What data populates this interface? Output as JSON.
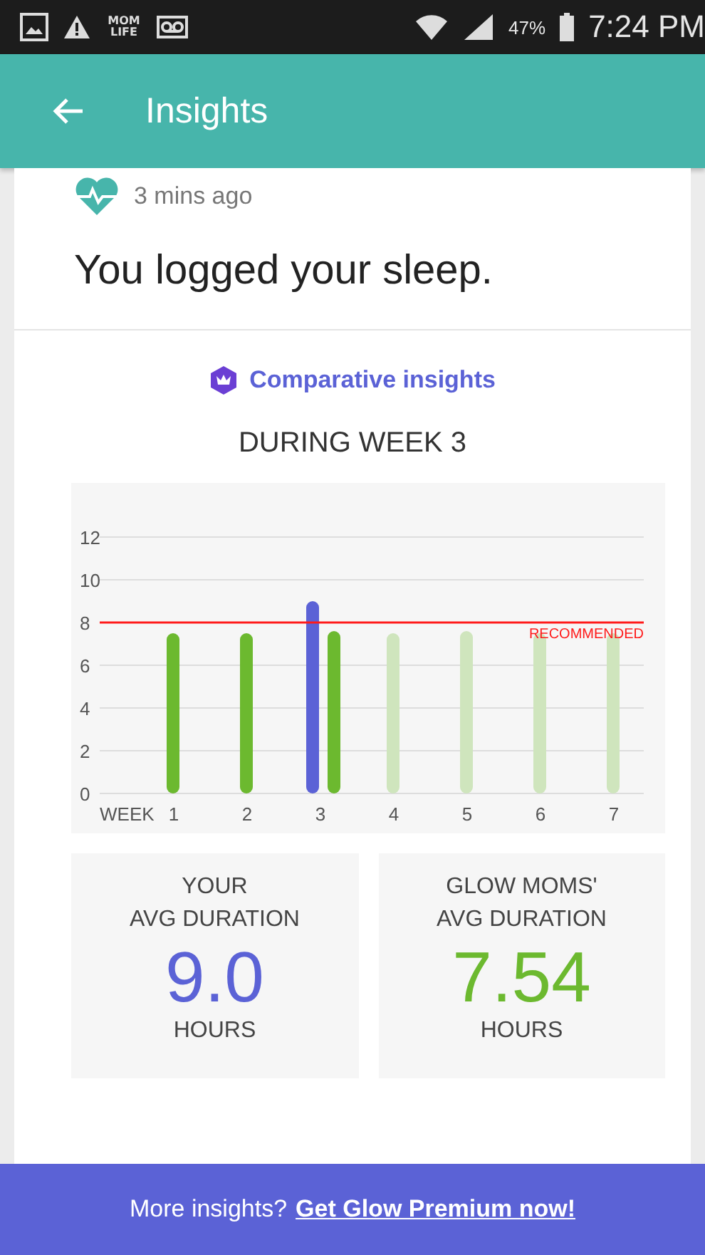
{
  "status_bar": {
    "notifications": [
      {
        "kind": "picture"
      },
      {
        "kind": "warning"
      },
      {
        "kind": "app",
        "label": "MOM LIFE"
      },
      {
        "kind": "voicemail"
      }
    ],
    "battery": "47%",
    "time": "7:24 PM"
  },
  "app_bar": {
    "title": "Insights"
  },
  "card": {
    "time": "3 mins ago",
    "title": "You logged your sleep.",
    "insights_label": "Comparative insights",
    "period": "DURING WEEK 3",
    "chart_data": {
      "type": "bar",
      "categories": [
        "1",
        "2",
        "3",
        "4",
        "5",
        "6",
        "7"
      ],
      "xlabel": "WEEK",
      "ylim": [
        0,
        12
      ],
      "yticks": [
        0,
        2,
        4,
        6,
        8,
        10,
        12
      ],
      "grid": true,
      "series": [
        {
          "color": "#5b62d6",
          "values": [
            null,
            null,
            9.0,
            null,
            null,
            null,
            null
          ]
        },
        {
          "color": "#6cb92f",
          "values": [
            7.5,
            7.5,
            7.6,
            null,
            null,
            null,
            null
          ]
        },
        {
          "color": "#cfe5bd",
          "values": [
            null,
            null,
            null,
            7.5,
            7.6,
            7.5,
            7.5
          ]
        }
      ],
      "ref_lines": [
        {
          "axis": "y",
          "value": 8,
          "label": "RECOMMENDED",
          "color": "#ff1a1a"
        }
      ]
    },
    "stats": [
      {
        "label_lines": [
          "YOUR",
          "AVG DURATION"
        ],
        "value": "9.0",
        "unit": "HOURS",
        "color": "#5b62d6"
      },
      {
        "label_lines": [
          "GLOW MOMS'",
          "AVG DURATION"
        ],
        "value": "7.54",
        "unit": "HOURS",
        "color": "#6cb92f"
      }
    ]
  },
  "banner": {
    "text": "More insights?",
    "link": "Get Glow Premium now!"
  }
}
